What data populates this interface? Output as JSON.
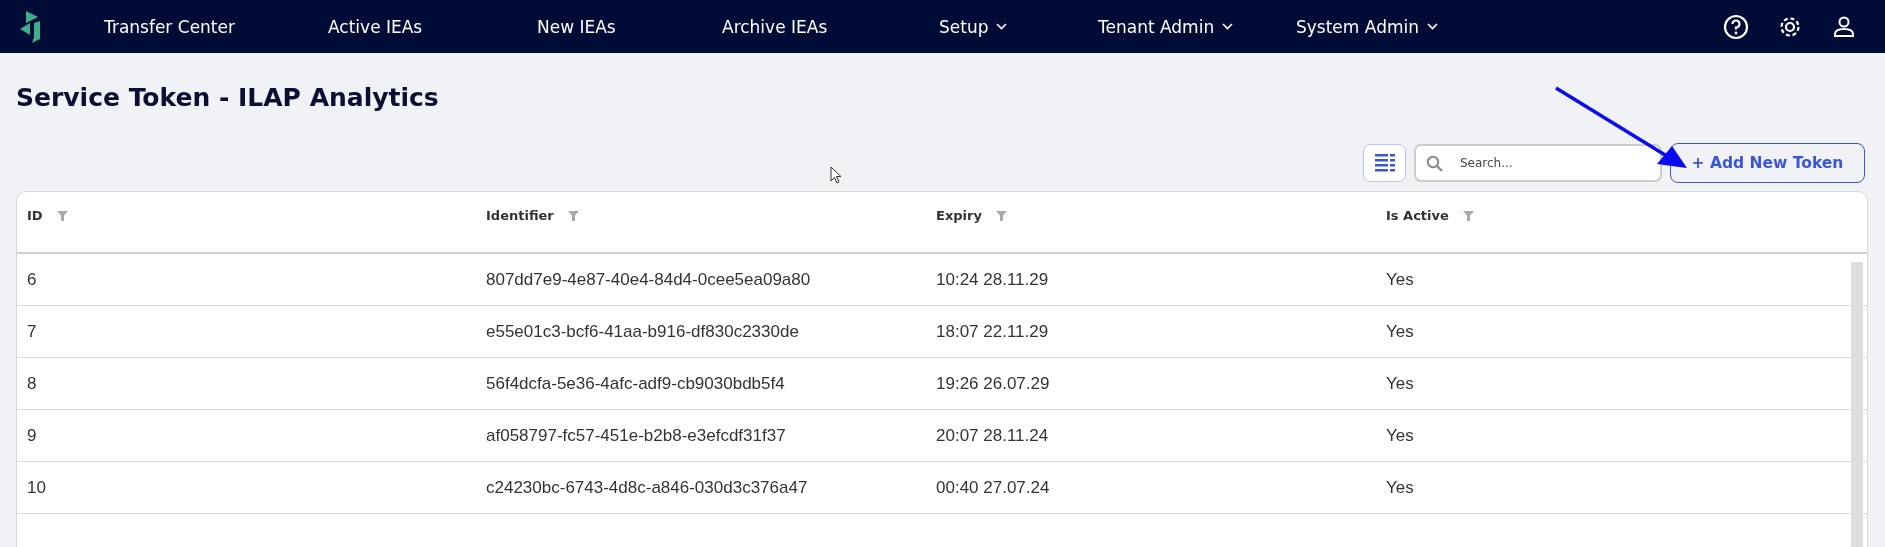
{
  "nav": {
    "items": [
      {
        "label": "Transfer Center",
        "dropdown": false
      },
      {
        "label": "Active IEAs",
        "dropdown": false
      },
      {
        "label": "New IEAs",
        "dropdown": false
      },
      {
        "label": "Archive IEAs",
        "dropdown": false
      },
      {
        "label": "Setup",
        "dropdown": true
      },
      {
        "label": "Tenant Admin",
        "dropdown": true
      },
      {
        "label": "System Admin",
        "dropdown": true
      }
    ]
  },
  "page_title": "Service Token - ILAP Analytics",
  "search": {
    "placeholder": "Search..."
  },
  "add_button": "+ Add New Token",
  "table": {
    "columns": [
      "ID",
      "Identifier",
      "Expiry",
      "Is Active"
    ],
    "rows": [
      [
        "6",
        "807dd7e9-4e87-40e4-84d4-0cee5ea09a80",
        "10:24 28.11.29",
        "Yes"
      ],
      [
        "7",
        "e55e01c3-bcf6-41aa-b916-df830c2330de",
        "18:07 22.11.29",
        "Yes"
      ],
      [
        "8",
        "56f4dcfa-5e36-4afc-adf9-cb9030bdb5f4",
        "19:26 26.07.29",
        "Yes"
      ],
      [
        "9",
        "af058797-fc57-451e-b2b8-e3efcdf31f37",
        "20:07 28.11.24",
        "Yes"
      ],
      [
        "10",
        "c24230bc-6743-4d8c-a846-030d3c376a47",
        "00:40 27.07.24",
        "Yes"
      ]
    ]
  }
}
